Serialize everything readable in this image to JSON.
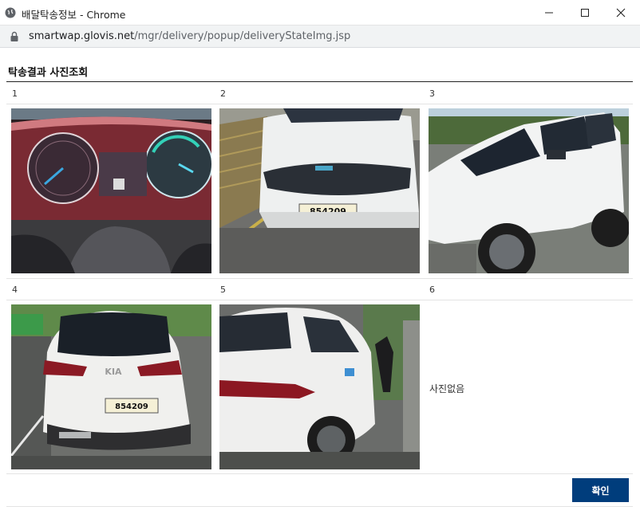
{
  "window": {
    "title": "배달탁송정보 - Chrome",
    "url_host": "smartwap.glovis.net",
    "url_path": "/mgr/delivery/popup/deliveryStateImg.jsp"
  },
  "page": {
    "heading": "탁송결과 사진조회",
    "cells": [
      {
        "label": "1",
        "photo": "dashboard-cluster"
      },
      {
        "label": "2",
        "photo": "car-front"
      },
      {
        "label": "3",
        "photo": "car-side"
      },
      {
        "label": "4",
        "photo": "car-rear"
      },
      {
        "label": "5",
        "photo": "car-rear-side"
      },
      {
        "label": "6",
        "photo": null,
        "empty_text": "사진없음"
      }
    ],
    "plates": {
      "front": "854209",
      "rear": "854209"
    },
    "confirm_label": "확인"
  },
  "colors": {
    "confirm_button": "#003d7c"
  }
}
